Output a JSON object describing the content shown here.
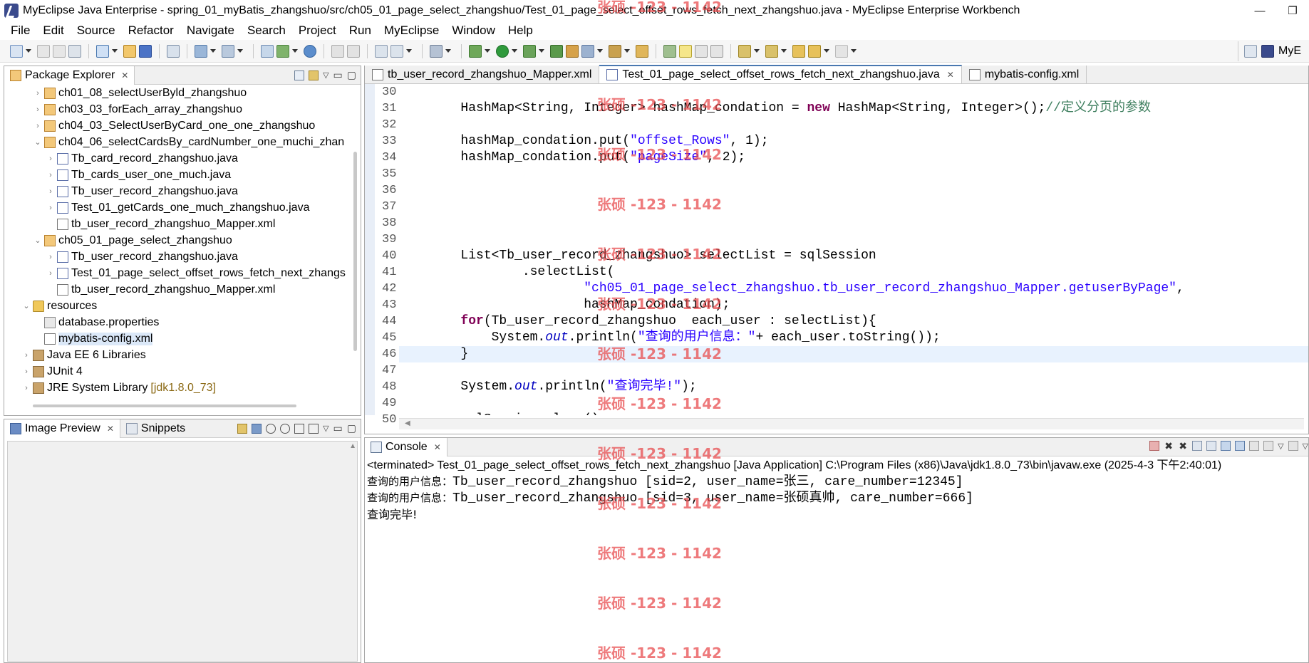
{
  "window": {
    "title": "MyEclipse Java Enterprise - spring_01_myBatis_zhangshuo/src/ch05_01_page_select_zhangshuo/Test_01_page_select_offset_rows_fetch_next_zhangshuo.java - MyEclipse Enterprise Workbench",
    "controls": [
      "—",
      "❐"
    ]
  },
  "menu": [
    "File",
    "Edit",
    "Source",
    "Refactor",
    "Navigate",
    "Search",
    "Project",
    "Run",
    "MyEclipse",
    "Window",
    "Help"
  ],
  "perspective": {
    "label": "MyE"
  },
  "package_explorer": {
    "title": "Package Explorer",
    "items": [
      {
        "label": "ch01_08_selectUserByld_zhangshuo",
        "type": "package",
        "level": 1,
        "expanded": false
      },
      {
        "label": "ch03_03_forEach_array_zhangshuo",
        "type": "package",
        "level": 1,
        "expanded": false
      },
      {
        "label": "ch04_03_SelectUserByCard_one_one_zhangshuo",
        "type": "package",
        "level": 1,
        "expanded": false
      },
      {
        "label": "ch04_06_selectCardsBy_cardNumber_one_muchi_zhan",
        "type": "package",
        "level": 1,
        "expanded": true
      },
      {
        "label": "Tb_card_record_zhangshuo.java",
        "type": "java",
        "level": 2,
        "expanded": false
      },
      {
        "label": "Tb_cards_user_one_much.java",
        "type": "java",
        "level": 2,
        "expanded": false
      },
      {
        "label": "Tb_user_record_zhangshuo.java",
        "type": "java",
        "level": 2,
        "expanded": false
      },
      {
        "label": "Test_01_getCards_one_much_zhangshuo.java",
        "type": "java",
        "level": 2,
        "expanded": false
      },
      {
        "label": "tb_user_record_zhangshuo_Mapper.xml",
        "type": "xml",
        "level": 2,
        "expanded": null
      },
      {
        "label": "ch05_01_page_select_zhangshuo",
        "type": "package",
        "level": 1,
        "expanded": true
      },
      {
        "label": "Tb_user_record_zhangshuo.java",
        "type": "java",
        "level": 2,
        "expanded": false
      },
      {
        "label": "Test_01_page_select_offset_rows_fetch_next_zhangs",
        "type": "java",
        "level": 2,
        "expanded": false
      },
      {
        "label": "tb_user_record_zhangshuo_Mapper.xml",
        "type": "xml",
        "level": 2,
        "expanded": null
      },
      {
        "label": "resources",
        "type": "folder",
        "level": 0,
        "expanded": true
      },
      {
        "label": "database.properties",
        "type": "props",
        "level": 1,
        "expanded": null
      },
      {
        "label": "mybatis-config.xml",
        "type": "xml",
        "level": 1,
        "expanded": null,
        "selected": true
      },
      {
        "label": "Java EE 6 Libraries",
        "type": "lib",
        "level": 0,
        "expanded": false
      },
      {
        "label": "JUnit 4",
        "type": "lib",
        "level": 0,
        "expanded": false
      },
      {
        "label": "JRE System Library",
        "type": "lib",
        "level": 0,
        "expanded": false,
        "suffix": "[jdk1.8.0_73]"
      }
    ]
  },
  "image_preview": {
    "tab1": "Image Preview",
    "tab2": "Snippets"
  },
  "editor": {
    "tabs": [
      {
        "label": "tb_user_record_zhangshuo_Mapper.xml",
        "active": false
      },
      {
        "label": "Test_01_page_select_offset_rows_fetch_next_zhangshuo.java",
        "active": true
      },
      {
        "label": "mybatis-config.xml",
        "active": false
      }
    ],
    "line_numbers": [
      "30",
      "31",
      "32",
      "33",
      "34",
      "35",
      "36",
      "37",
      "38",
      "39",
      "40",
      "41",
      "42",
      "43",
      "44",
      "45",
      "46",
      "47",
      "48",
      "49",
      "50"
    ],
    "lines": [
      [
        {
          "t": "        ",
          "c": ""
        }
      ],
      [
        {
          "t": "        HashMap<String, Integer> hashMap_condation = ",
          "c": ""
        },
        {
          "t": "new",
          "c": "kw"
        },
        {
          "t": " HashMap<String, Integer>();",
          "c": ""
        },
        {
          "t": "//定义分页的参数",
          "c": "cmt"
        }
      ],
      [
        {
          "t": "",
          "c": ""
        }
      ],
      [
        {
          "t": "        hashMap_condation.put(",
          "c": ""
        },
        {
          "t": "\"offset_Rows\"",
          "c": "str"
        },
        {
          "t": ", 1);",
          "c": ""
        }
      ],
      [
        {
          "t": "        hashMap_condation.put(",
          "c": ""
        },
        {
          "t": "\"pageSize\"",
          "c": "str"
        },
        {
          "t": ", 2);",
          "c": ""
        }
      ],
      [
        {
          "t": "",
          "c": ""
        }
      ],
      [
        {
          "t": "",
          "c": ""
        }
      ],
      [
        {
          "t": "",
          "c": ""
        }
      ],
      [
        {
          "t": "",
          "c": ""
        }
      ],
      [
        {
          "t": "",
          "c": ""
        }
      ],
      [
        {
          "t": "        List<Tb_user_record_zhangshuo> selectList = sqlSession",
          "c": ""
        }
      ],
      [
        {
          "t": "                .selectList(",
          "c": ""
        }
      ],
      [
        {
          "t": "                        ",
          "c": ""
        },
        {
          "t": "\"ch05_01_page_select_zhangshuo.tb_user_record_zhangshuo_Mapper.getuserByPage\"",
          "c": "str"
        },
        {
          "t": ",",
          "c": ""
        }
      ],
      [
        {
          "t": "                        hashMap_condation);",
          "c": ""
        }
      ],
      [
        {
          "t": "        ",
          "c": ""
        },
        {
          "t": "for",
          "c": "kw"
        },
        {
          "t": "(Tb_user_record_zhangshuo  each_user : selectList){",
          "c": ""
        }
      ],
      [
        {
          "t": "            System.",
          "c": ""
        },
        {
          "t": "out",
          "c": "fld"
        },
        {
          "t": ".println(",
          "c": ""
        },
        {
          "t": "\"查询的用户信息：\"",
          "c": "str"
        },
        {
          "t": "+ each_user.toString());",
          "c": ""
        }
      ],
      [
        {
          "t": "        }",
          "c": ""
        }
      ],
      [
        {
          "t": "",
          "c": ""
        }
      ],
      [
        {
          "t": "        System.",
          "c": ""
        },
        {
          "t": "out",
          "c": "fld"
        },
        {
          "t": ".println(",
          "c": ""
        },
        {
          "t": "\"查询完毕!\"",
          "c": "str"
        },
        {
          "t": ");",
          "c": ""
        }
      ],
      [
        {
          "t": "",
          "c": ""
        }
      ],
      [
        {
          "t": "        sqlSession.close();",
          "c": ""
        }
      ]
    ],
    "current_line_index": 16
  },
  "console": {
    "title": "Console",
    "status": "<terminated> Test_01_page_select_offset_rows_fetch_next_zhangshuo [Java Application] C:\\Program Files (x86)\\Java\\jdk1.8.0_73\\bin\\javaw.exe (2025-4-3 下午2:40:01)",
    "lines": [
      {
        "prefix": "查询的用户信息：",
        "text": "Tb_user_record_zhangshuo [sid=2, user_name=张三, care_number=12345]"
      },
      {
        "prefix": "查询的用户信息：",
        "text": "Tb_user_record_zhangshuo [sid=3, user_name=张硕真帅, care_number=666]"
      },
      {
        "prefix": "",
        "text": "查询完毕!"
      }
    ]
  },
  "watermark": {
    "text": "张硕 -123 - 1142",
    "color": "#e8484a"
  },
  "colors": {
    "keyword": "#7f0055",
    "string": "#2a00ff",
    "comment": "#3f7f5f",
    "field": "#0000c0",
    "current_line": "#e8f2fe"
  }
}
